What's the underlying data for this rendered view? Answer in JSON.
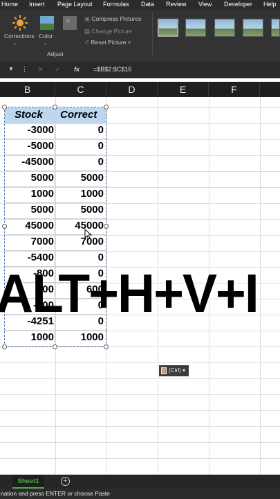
{
  "ribbon_tabs": [
    "Home",
    "Insert",
    "Page Layout",
    "Formulas",
    "Data",
    "Review",
    "View",
    "Developer",
    "Help"
  ],
  "adjust_group": {
    "corrections": "Corrections",
    "color": "Color",
    "artistic": "Artistic Effects",
    "compress": "Compress Pictures",
    "change": "Change Picture",
    "reset": "Reset Picture",
    "group_label": "Adjust"
  },
  "formula_bar": {
    "fx": "fx",
    "formula": "=$B$2:$C$16"
  },
  "columns": [
    "B",
    "C",
    "D",
    "E",
    "F"
  ],
  "table": {
    "headers": [
      "Stock",
      "Correct"
    ],
    "rows": [
      [
        "-3000",
        "0"
      ],
      [
        "-5000",
        "0"
      ],
      [
        "-45000",
        "0"
      ],
      [
        "5000",
        "5000"
      ],
      [
        "1000",
        "1000"
      ],
      [
        "5000",
        "5000"
      ],
      [
        "45000",
        "45000"
      ],
      [
        "7000",
        "7000"
      ],
      [
        "-5400",
        "0"
      ],
      [
        "-800",
        "0"
      ],
      [
        "600",
        "600"
      ],
      [
        "-100",
        "0"
      ],
      [
        "-4251",
        "0"
      ],
      [
        "1000",
        "1000"
      ]
    ]
  },
  "overlay_text": "ALT+H+V+I",
  "paste_options": "(Ctrl)",
  "sheet_tab": "Sheet1",
  "add_sheet": "+",
  "status_text": "nation and press ENTER or choose Paste"
}
